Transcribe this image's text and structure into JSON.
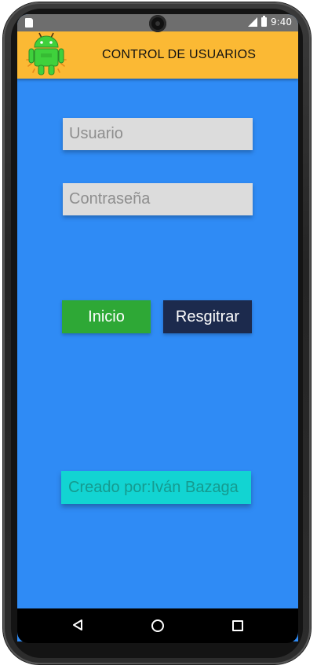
{
  "status_bar": {
    "time": "9:40"
  },
  "app_bar": {
    "title": "CONTROL DE USUARIOS",
    "logo_icon": "android-robot-icon",
    "color": "#fbb934"
  },
  "form": {
    "user_placeholder": "Usuario",
    "user_value": "",
    "password_placeholder": "Contraseña",
    "password_value": ""
  },
  "buttons": {
    "login_label": "Inicio",
    "login_color": "#2ea836",
    "register_label": "Resgitrar",
    "register_color": "#1c2a4d"
  },
  "footer": {
    "credit": "Creado por:Iván Bazaga"
  },
  "colors": {
    "background": "#2f8bf5",
    "credit_background": "#12d4d2",
    "credit_text": "#159a8f"
  },
  "nav_bar": {
    "back_icon": "back-triangle-icon",
    "home_icon": "home-circle-icon",
    "recents_icon": "recents-square-icon"
  }
}
